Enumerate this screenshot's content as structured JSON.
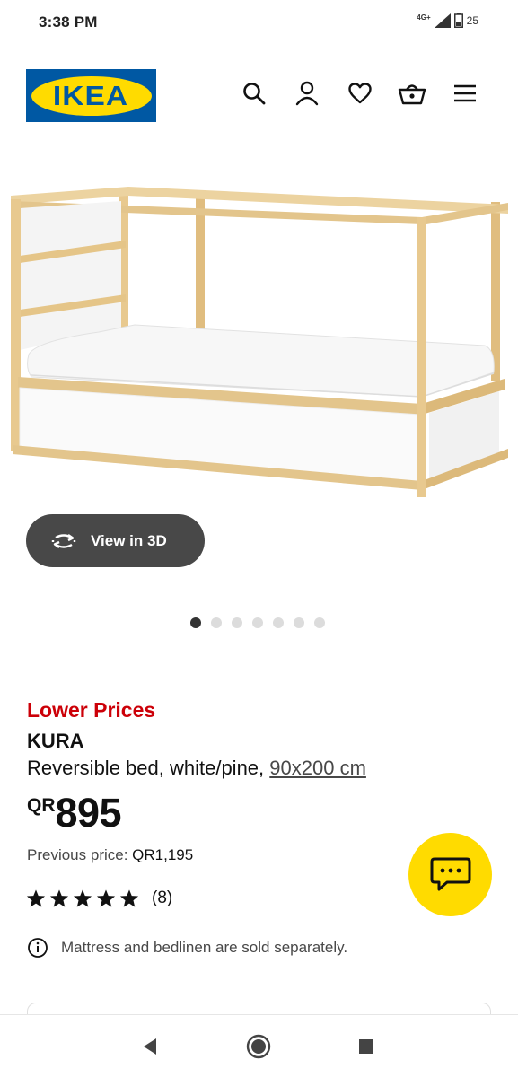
{
  "status_bar": {
    "time": "3:38 PM",
    "network": "4G+",
    "battery": "25",
    "icons": [
      "signal-icon",
      "battery-icon"
    ]
  },
  "header": {
    "logo_text": "IKEA",
    "icons": [
      "search-icon",
      "account-icon",
      "heart-icon",
      "cart-icon",
      "menu-icon"
    ]
  },
  "media": {
    "view_3d_label": "View in 3D",
    "dot_count": 7,
    "active_dot": 0
  },
  "product": {
    "promo_label": "Lower Prices",
    "name": "KURA",
    "description": "Reversible bed, white/pine,",
    "size": "90x200 cm",
    "currency": "QR",
    "price": "895",
    "previous_price_label": "Previous price:",
    "previous_price_value": "QR1,195",
    "rating_stars": 5,
    "review_count": "(8)",
    "notice": "Mattress and bedlinen are sold separately."
  },
  "colors": {
    "brand_blue": "#0058a3",
    "brand_yellow": "#ffdb00",
    "promo_red": "#cc0008",
    "view3d_bg": "#484848"
  },
  "nav_bar": {
    "icons": [
      "back-icon",
      "home-icon",
      "recents-icon"
    ]
  }
}
